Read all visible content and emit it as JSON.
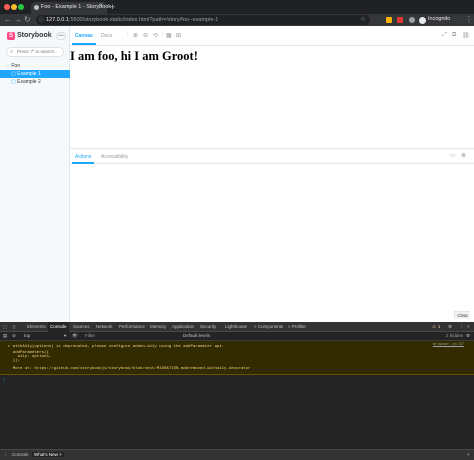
{
  "browser": {
    "tab_title": "Foo - Example 1 - Storybook",
    "tab_close": "×",
    "new_tab": "+",
    "url_host": "127.0.0.1",
    "url_rest": ":5500/storybook-static/index.html?path=/story/foo--example-1",
    "profile_label": "Incognito",
    "icons": [
      "back-icon",
      "forward-icon",
      "reload-icon",
      "star-icon",
      "extension-icon",
      "menu-icon"
    ]
  },
  "storybook": {
    "brand": "Storybook",
    "search_placeholder": "Press \"/\" to search...",
    "tree": {
      "group": "Foo",
      "items": [
        "Example 1",
        "Example 2"
      ]
    },
    "tabs": {
      "canvas": "Canvas",
      "docs": "Docs"
    },
    "preview_heading": "I am foo, hi I am Groot!",
    "addon_tabs": {
      "actions": "Actions",
      "accessibility": "Accessibility"
    },
    "clear_label": "Clear",
    "accent": "#1ea7fd",
    "logo_color": "#ff4785"
  },
  "devtools": {
    "tabs": [
      "Elements",
      "Console",
      "Sources",
      "Network",
      "Performance",
      "Memory",
      "Application",
      "Security",
      "Lighthouse",
      "» Components",
      "» Profiler"
    ],
    "warning_count": "1",
    "context": "top",
    "filter_placeholder": "Filter",
    "levels": "Default levels",
    "hidden_count": "2 hidden",
    "warning_lines": [
      "▸ withA11y(options) is deprecated, please configure addon-a11y using the addParameter api:",
      "",
      "  addParameters({",
      "    a11y: options,",
      "  });",
      "",
      "  More at: https://github.com/storybookjs/storybook/blob/next/MIGRATION.md#removed-witha11y-decorator"
    ],
    "warning_source": "browser.js:37",
    "prompt": "›",
    "drawer_tabs": [
      "Console",
      "What's New ×"
    ]
  }
}
